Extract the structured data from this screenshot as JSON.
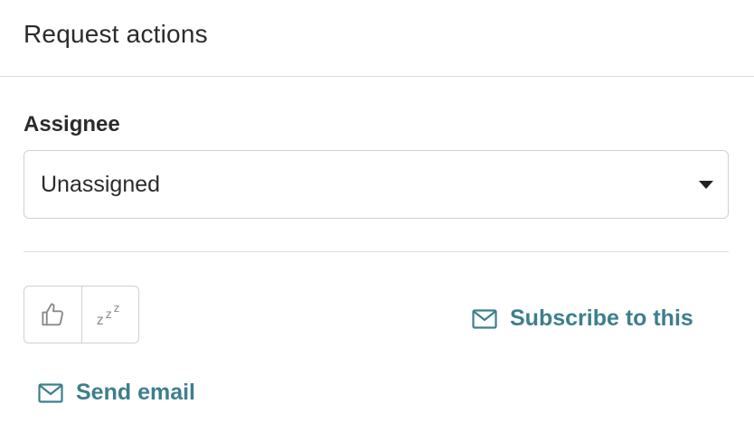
{
  "panel": {
    "title": "Request actions"
  },
  "assignee": {
    "label": "Assignee",
    "selected": "Unassigned"
  },
  "votes": {
    "upvote_icon": "thumbs-up-icon",
    "snooze_icon": "snooze-icon",
    "snooze_text": "zzz"
  },
  "actions": {
    "subscribe_label": "Subscribe to this",
    "send_email_label": "Send email",
    "mail_icon": "mail-icon"
  },
  "colors": {
    "accent": "#3d7f8c",
    "border": "#d0d0d0",
    "text": "#2b2b2b"
  }
}
